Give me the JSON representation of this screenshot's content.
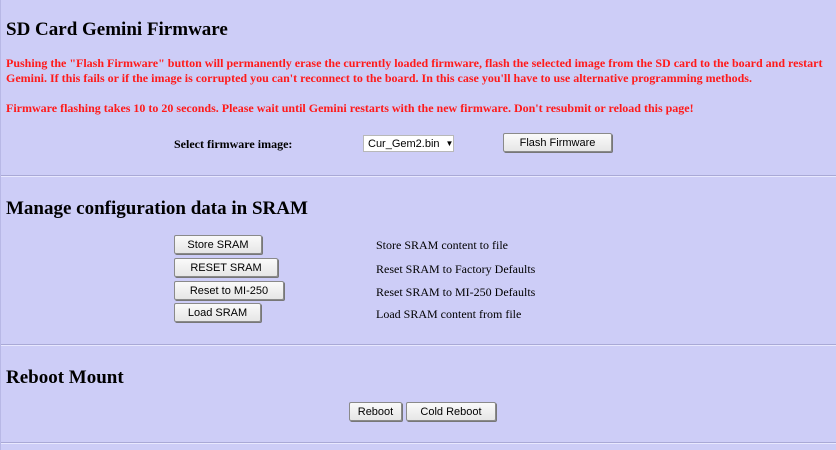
{
  "firmware": {
    "title": "SD Card Gemini Firmware",
    "warning_line1": "Pushing the \"Flash Firmware\" button will permanently erase the currently loaded firmware, flash the selected image from the SD card to the board and restart",
    "warning_line2": "Gemini. If this fails or if the image is corrupted you can't reconnect to the board. In this case you'll have to use alternative programming methods.",
    "warning_line3": "Firmware flashing takes 10 to 20 seconds. Please wait until Gemini restarts with the new firmware. Don't resubmit or reload this page!",
    "select_label": "Select firmware image:",
    "selected_image": "Cur_Gem2.bin",
    "flash_button": "Flash Firmware"
  },
  "sram": {
    "title": "Manage configuration data in SRAM",
    "actions": [
      {
        "button": "Store SRAM",
        "description": "Store SRAM content to file"
      },
      {
        "button": "RESET SRAM",
        "description": "Reset SRAM to Factory Defaults"
      },
      {
        "button": "Reset to MI-250",
        "description": "Reset SRAM to MI-250 Defaults"
      },
      {
        "button": "Load SRAM",
        "description": "Load SRAM content from file"
      }
    ]
  },
  "reboot": {
    "title": "Reboot Mount",
    "reboot_button": "Reboot",
    "cold_reboot_button": "Cold Reboot"
  },
  "icons": {
    "select_caret": "chevron-down-icon"
  }
}
